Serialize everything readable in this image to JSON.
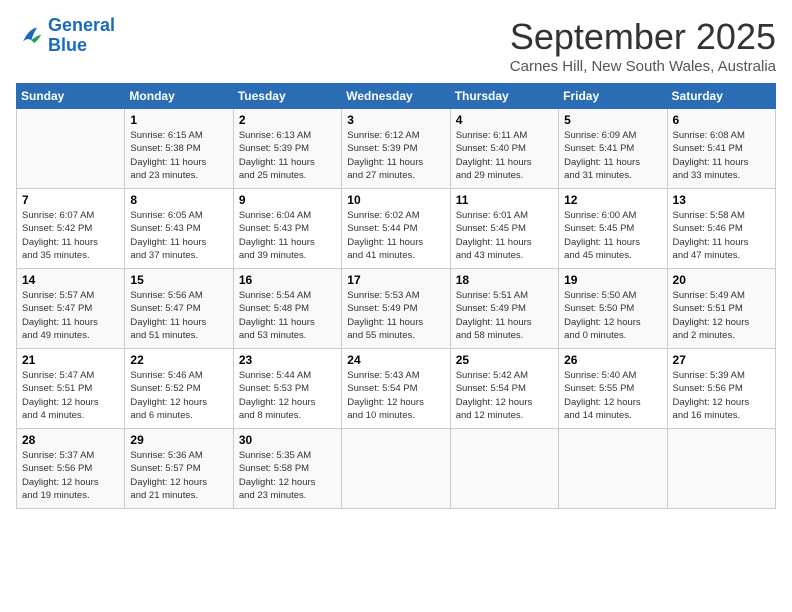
{
  "logo": {
    "line1": "General",
    "line2": "Blue"
  },
  "title": "September 2025",
  "subtitle": "Carnes Hill, New South Wales, Australia",
  "days_header": [
    "Sunday",
    "Monday",
    "Tuesday",
    "Wednesday",
    "Thursday",
    "Friday",
    "Saturday"
  ],
  "weeks": [
    [
      {
        "num": "",
        "sunrise": "",
        "sunset": "",
        "daylight": ""
      },
      {
        "num": "1",
        "sunrise": "Sunrise: 6:15 AM",
        "sunset": "Sunset: 5:38 PM",
        "daylight": "Daylight: 11 hours and 23 minutes."
      },
      {
        "num": "2",
        "sunrise": "Sunrise: 6:13 AM",
        "sunset": "Sunset: 5:39 PM",
        "daylight": "Daylight: 11 hours and 25 minutes."
      },
      {
        "num": "3",
        "sunrise": "Sunrise: 6:12 AM",
        "sunset": "Sunset: 5:39 PM",
        "daylight": "Daylight: 11 hours and 27 minutes."
      },
      {
        "num": "4",
        "sunrise": "Sunrise: 6:11 AM",
        "sunset": "Sunset: 5:40 PM",
        "daylight": "Daylight: 11 hours and 29 minutes."
      },
      {
        "num": "5",
        "sunrise": "Sunrise: 6:09 AM",
        "sunset": "Sunset: 5:41 PM",
        "daylight": "Daylight: 11 hours and 31 minutes."
      },
      {
        "num": "6",
        "sunrise": "Sunrise: 6:08 AM",
        "sunset": "Sunset: 5:41 PM",
        "daylight": "Daylight: 11 hours and 33 minutes."
      }
    ],
    [
      {
        "num": "7",
        "sunrise": "Sunrise: 6:07 AM",
        "sunset": "Sunset: 5:42 PM",
        "daylight": "Daylight: 11 hours and 35 minutes."
      },
      {
        "num": "8",
        "sunrise": "Sunrise: 6:05 AM",
        "sunset": "Sunset: 5:43 PM",
        "daylight": "Daylight: 11 hours and 37 minutes."
      },
      {
        "num": "9",
        "sunrise": "Sunrise: 6:04 AM",
        "sunset": "Sunset: 5:43 PM",
        "daylight": "Daylight: 11 hours and 39 minutes."
      },
      {
        "num": "10",
        "sunrise": "Sunrise: 6:02 AM",
        "sunset": "Sunset: 5:44 PM",
        "daylight": "Daylight: 11 hours and 41 minutes."
      },
      {
        "num": "11",
        "sunrise": "Sunrise: 6:01 AM",
        "sunset": "Sunset: 5:45 PM",
        "daylight": "Daylight: 11 hours and 43 minutes."
      },
      {
        "num": "12",
        "sunrise": "Sunrise: 6:00 AM",
        "sunset": "Sunset: 5:45 PM",
        "daylight": "Daylight: 11 hours and 45 minutes."
      },
      {
        "num": "13",
        "sunrise": "Sunrise: 5:58 AM",
        "sunset": "Sunset: 5:46 PM",
        "daylight": "Daylight: 11 hours and 47 minutes."
      }
    ],
    [
      {
        "num": "14",
        "sunrise": "Sunrise: 5:57 AM",
        "sunset": "Sunset: 5:47 PM",
        "daylight": "Daylight: 11 hours and 49 minutes."
      },
      {
        "num": "15",
        "sunrise": "Sunrise: 5:56 AM",
        "sunset": "Sunset: 5:47 PM",
        "daylight": "Daylight: 11 hours and 51 minutes."
      },
      {
        "num": "16",
        "sunrise": "Sunrise: 5:54 AM",
        "sunset": "Sunset: 5:48 PM",
        "daylight": "Daylight: 11 hours and 53 minutes."
      },
      {
        "num": "17",
        "sunrise": "Sunrise: 5:53 AM",
        "sunset": "Sunset: 5:49 PM",
        "daylight": "Daylight: 11 hours and 55 minutes."
      },
      {
        "num": "18",
        "sunrise": "Sunrise: 5:51 AM",
        "sunset": "Sunset: 5:49 PM",
        "daylight": "Daylight: 11 hours and 58 minutes."
      },
      {
        "num": "19",
        "sunrise": "Sunrise: 5:50 AM",
        "sunset": "Sunset: 5:50 PM",
        "daylight": "Daylight: 12 hours and 0 minutes."
      },
      {
        "num": "20",
        "sunrise": "Sunrise: 5:49 AM",
        "sunset": "Sunset: 5:51 PM",
        "daylight": "Daylight: 12 hours and 2 minutes."
      }
    ],
    [
      {
        "num": "21",
        "sunrise": "Sunrise: 5:47 AM",
        "sunset": "Sunset: 5:51 PM",
        "daylight": "Daylight: 12 hours and 4 minutes."
      },
      {
        "num": "22",
        "sunrise": "Sunrise: 5:46 AM",
        "sunset": "Sunset: 5:52 PM",
        "daylight": "Daylight: 12 hours and 6 minutes."
      },
      {
        "num": "23",
        "sunrise": "Sunrise: 5:44 AM",
        "sunset": "Sunset: 5:53 PM",
        "daylight": "Daylight: 12 hours and 8 minutes."
      },
      {
        "num": "24",
        "sunrise": "Sunrise: 5:43 AM",
        "sunset": "Sunset: 5:54 PM",
        "daylight": "Daylight: 12 hours and 10 minutes."
      },
      {
        "num": "25",
        "sunrise": "Sunrise: 5:42 AM",
        "sunset": "Sunset: 5:54 PM",
        "daylight": "Daylight: 12 hours and 12 minutes."
      },
      {
        "num": "26",
        "sunrise": "Sunrise: 5:40 AM",
        "sunset": "Sunset: 5:55 PM",
        "daylight": "Daylight: 12 hours and 14 minutes."
      },
      {
        "num": "27",
        "sunrise": "Sunrise: 5:39 AM",
        "sunset": "Sunset: 5:56 PM",
        "daylight": "Daylight: 12 hours and 16 minutes."
      }
    ],
    [
      {
        "num": "28",
        "sunrise": "Sunrise: 5:37 AM",
        "sunset": "Sunset: 5:56 PM",
        "daylight": "Daylight: 12 hours and 19 minutes."
      },
      {
        "num": "29",
        "sunrise": "Sunrise: 5:36 AM",
        "sunset": "Sunset: 5:57 PM",
        "daylight": "Daylight: 12 hours and 21 minutes."
      },
      {
        "num": "30",
        "sunrise": "Sunrise: 5:35 AM",
        "sunset": "Sunset: 5:58 PM",
        "daylight": "Daylight: 12 hours and 23 minutes."
      },
      {
        "num": "",
        "sunrise": "",
        "sunset": "",
        "daylight": ""
      },
      {
        "num": "",
        "sunrise": "",
        "sunset": "",
        "daylight": ""
      },
      {
        "num": "",
        "sunrise": "",
        "sunset": "",
        "daylight": ""
      },
      {
        "num": "",
        "sunrise": "",
        "sunset": "",
        "daylight": ""
      }
    ]
  ]
}
